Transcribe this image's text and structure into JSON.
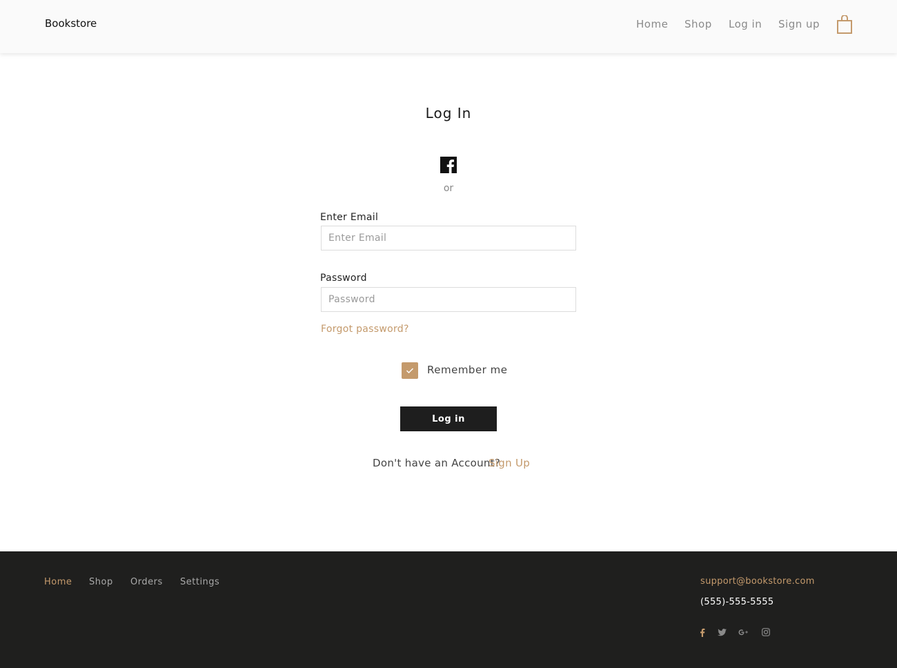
{
  "header": {
    "brand": "Bookstore",
    "nav": [
      "Home",
      "Shop",
      "Log in",
      "Sign up"
    ]
  },
  "main": {
    "title": "Log In",
    "or_text": "or",
    "email_label": "Enter Email",
    "email_placeholder": "Enter Email",
    "password_label": "Password",
    "password_placeholder": "Password",
    "forgot": "Forgot password?",
    "remember": "Remember me",
    "remember_checked": true,
    "login_button": "Log in",
    "no_account": "Don't have an Account?",
    "signup_link": "Sign Up"
  },
  "footer": {
    "nav": [
      "Home",
      "Shop",
      "Orders",
      "Settings"
    ],
    "email": "support@bookstore.com",
    "phone": "(555)-555-5555",
    "social": [
      "facebook-icon",
      "twitter-icon",
      "google-plus-icon",
      "instagram-icon"
    ]
  },
  "colors": {
    "accent": "#c49a6c",
    "dark": "#1f1f1e",
    "nav_gray": "#8a8a8a"
  }
}
